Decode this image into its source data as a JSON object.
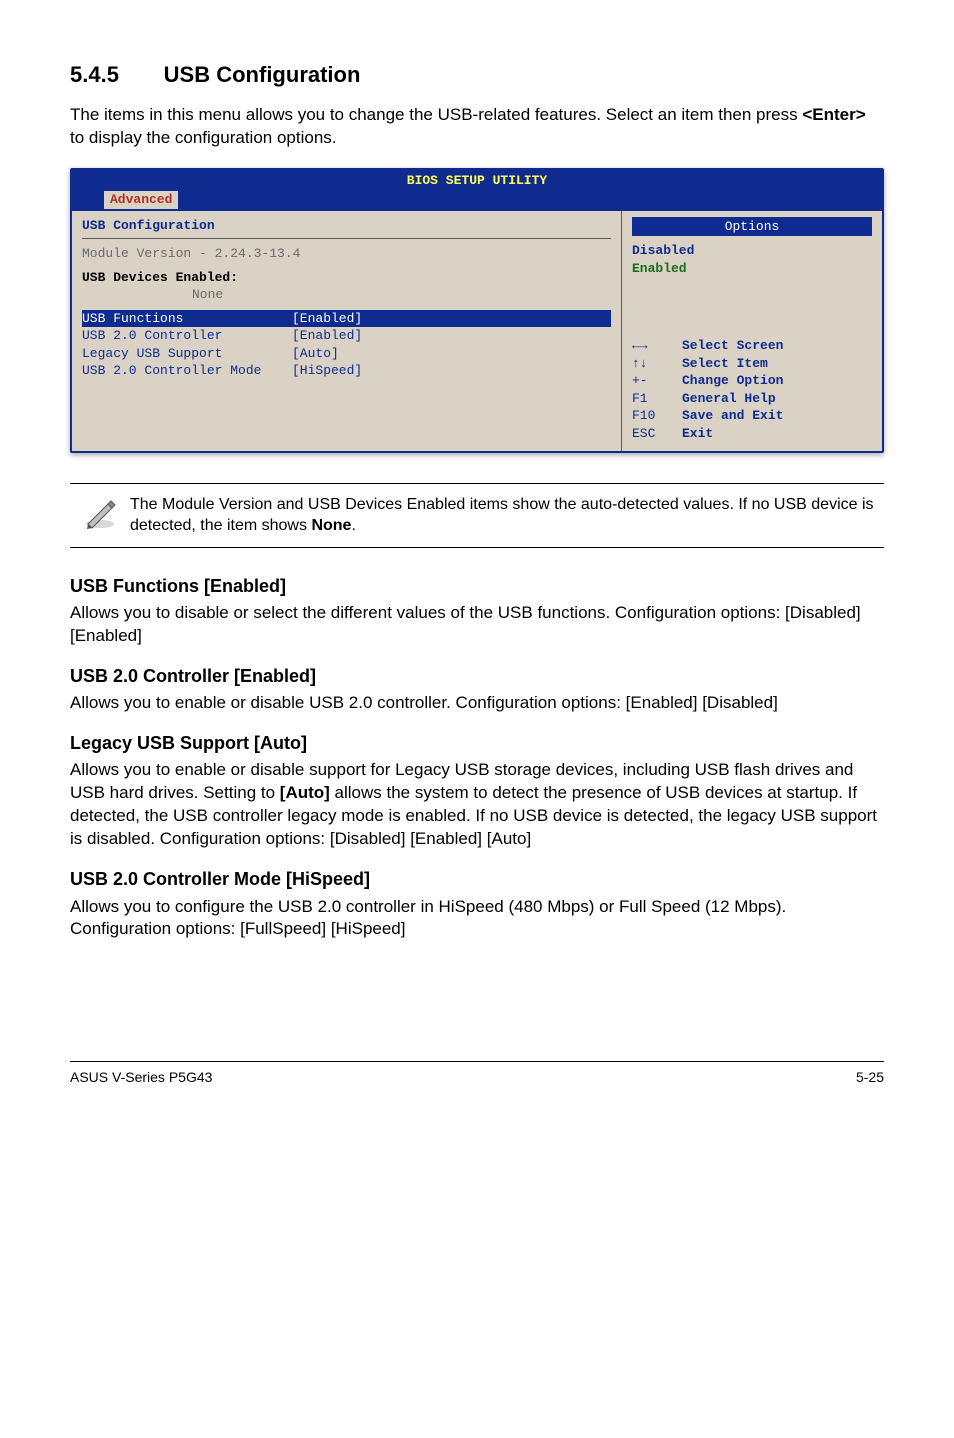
{
  "section": {
    "number": "5.4.5",
    "title": "USB Configuration"
  },
  "intro_pre": "The items in this menu allows you to change the USB-related features. Select an item then press ",
  "intro_key": "<Enter>",
  "intro_post": " to display the configuration options.",
  "bios": {
    "utility_title": "BIOS SETUP UTILITY",
    "tab": "Advanced",
    "left_header": "USB Configuration",
    "module_version": "Module Version - 2.24.3-13.4",
    "devices_label": "USB Devices Enabled:",
    "devices_value": "None",
    "rows": [
      {
        "label": "USB Functions",
        "value": "[Enabled]",
        "hl": true
      },
      {
        "label": "USB 2.0 Controller",
        "value": "[Enabled]",
        "hl": false
      },
      {
        "label": "Legacy USB Support",
        "value": "[Auto]",
        "hl": false
      },
      {
        "label": "USB 2.0 Controller Mode",
        "value": "[HiSpeed]",
        "hl": false
      }
    ],
    "options_title": "Options",
    "options": {
      "disabled": "Disabled",
      "enabled": "Enabled"
    },
    "help": [
      {
        "key": "←→",
        "desc": "Select Screen"
      },
      {
        "key": "↑↓",
        "desc": "Select Item"
      },
      {
        "key": "+-",
        "desc": "Change Option"
      },
      {
        "key": "F1",
        "desc": "General Help"
      },
      {
        "key": "F10",
        "desc": "Save and Exit"
      },
      {
        "key": "ESC",
        "desc": "Exit"
      }
    ]
  },
  "note_pre": "The Module Version and USB Devices Enabled items show the auto-detected values. If no USB device is detected, the item shows ",
  "note_bold": "None",
  "note_post": ".",
  "usb_functions": {
    "heading": "USB Functions [Enabled]",
    "body": "Allows you to disable or select the different values of the USB functions. Configuration options: [Disabled] [Enabled]"
  },
  "usb20_controller": {
    "heading": "USB 2.0 Controller [Enabled]",
    "body": "Allows you to enable or disable USB 2.0 controller. Configuration options: [Enabled] [Disabled]"
  },
  "legacy": {
    "heading": "Legacy USB Support [Auto]",
    "body_pre": "Allows you to enable or disable support for Legacy USB storage devices, including USB flash drives and USB hard drives. Setting to ",
    "body_bold": "[Auto]",
    "body_post": " allows the system to detect the presence of USB devices at startup. If detected, the USB controller legacy mode is enabled. If no USB device is detected, the legacy USB support is disabled. Configuration options: [Disabled] [Enabled] [Auto]"
  },
  "usb20_mode": {
    "heading": "USB 2.0 Controller Mode [HiSpeed]",
    "body": "Allows you to configure the USB 2.0 controller in HiSpeed (480 Mbps) or Full Speed (12 Mbps). Configuration options: [FullSpeed] [HiSpeed]"
  },
  "footer": {
    "left": "ASUS V-Series P5G43",
    "right": "5-25"
  }
}
